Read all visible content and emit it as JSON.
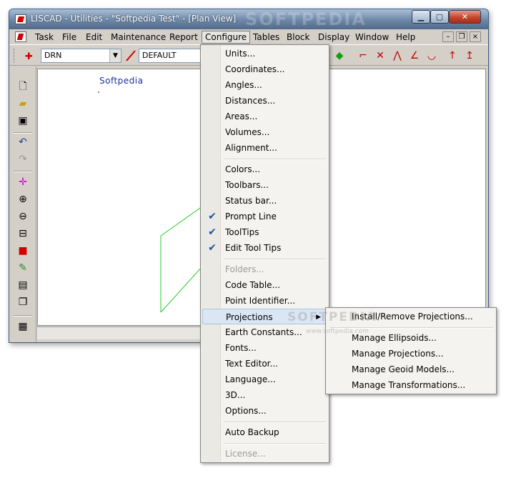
{
  "window": {
    "title": "LISCAD - Utilities - \"Softpedia Test\" - [Plan View]",
    "watermark": "SOFTPEDIA"
  },
  "titlebar_buttons": {
    "minimize": "▁",
    "maximize": "▢",
    "close": "✕"
  },
  "menubar": {
    "items": [
      "Task",
      "File",
      "Edit",
      "Maintenance",
      "Report",
      "Configure",
      "Tables",
      "Block",
      "Display",
      "Window",
      "Help"
    ],
    "active": "Configure",
    "mdi_minimize": "–",
    "mdi_restore": "❐",
    "mdi_close": "×"
  },
  "toolbar": {
    "point_combo_value": "DRN",
    "layer_combo_value": "DEFAULT"
  },
  "canvas": {
    "label": "Softpedia"
  },
  "configure_menu": {
    "groups": [
      [
        {
          "label": "Units..."
        },
        {
          "label": "Coordinates..."
        },
        {
          "label": "Angles..."
        },
        {
          "label": "Distances..."
        },
        {
          "label": "Areas..."
        },
        {
          "label": "Volumes..."
        },
        {
          "label": "Alignment..."
        }
      ],
      [
        {
          "label": "Colors..."
        },
        {
          "label": "Toolbars..."
        },
        {
          "label": "Status bar..."
        },
        {
          "label": "Prompt Line",
          "checked": true
        },
        {
          "label": "ToolTips",
          "checked": true
        },
        {
          "label": "Edit Tool Tips",
          "checked": true
        }
      ],
      [
        {
          "label": "Folders...",
          "disabled": true
        },
        {
          "label": "Code Table..."
        },
        {
          "label": "Point Identifier..."
        },
        {
          "label": "Projections",
          "submenu": true,
          "highlight": true
        },
        {
          "label": "Earth Constants..."
        },
        {
          "label": "Fonts..."
        },
        {
          "label": "Text Editor..."
        },
        {
          "label": "Language..."
        },
        {
          "label": "3D..."
        },
        {
          "label": "Options..."
        }
      ],
      [
        {
          "label": "Auto Backup"
        }
      ],
      [
        {
          "label": "License...",
          "disabled": true
        }
      ]
    ]
  },
  "projections_menu": {
    "groups": [
      [
        {
          "label": "Install/Remove Projections..."
        }
      ],
      [
        {
          "label": "Manage Ellipsoids..."
        },
        {
          "label": "Manage Projections..."
        },
        {
          "label": "Manage Geoid Models..."
        },
        {
          "label": "Manage Transformations..."
        }
      ]
    ]
  },
  "overlay_watermark": {
    "main": "SOFTPEDIA",
    "url": "www.softpedia.com"
  },
  "colors": {
    "accent": "#dbe6f4",
    "check": "#1b4fa8",
    "drawing": "#22cc22"
  }
}
